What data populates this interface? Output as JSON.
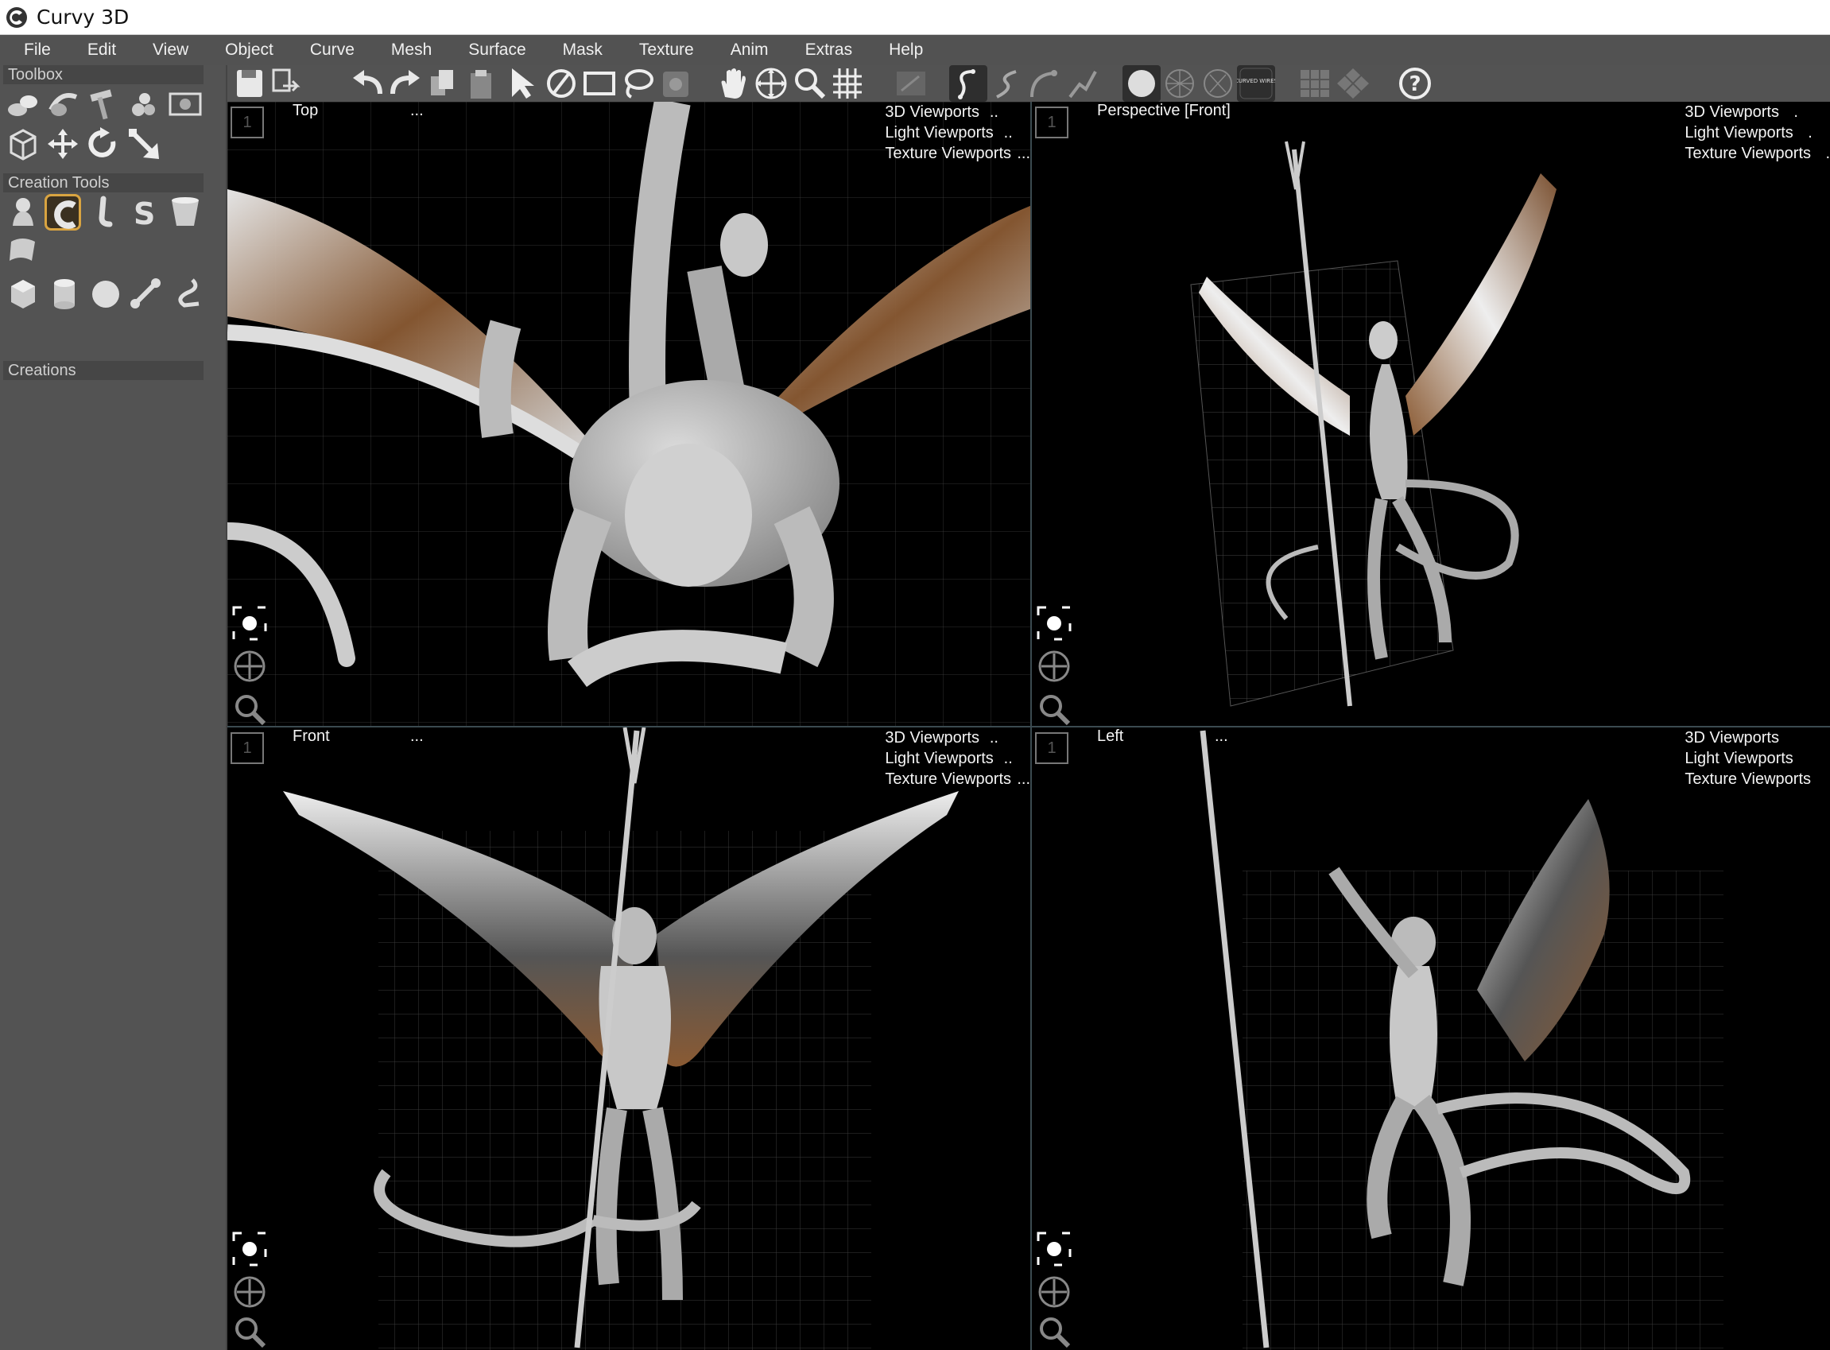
{
  "window": {
    "title": "Curvy 3D"
  },
  "menubar": {
    "items": [
      "File",
      "Edit",
      "View",
      "Object",
      "Curve",
      "Mesh",
      "Surface",
      "Mask",
      "Texture",
      "Anim",
      "Extras",
      "Help"
    ]
  },
  "leftpanel": {
    "toolbox_label": "Toolbox",
    "creation_tools_label": "Creation Tools",
    "creations_label": "Creations"
  },
  "toolbar": {
    "surface_badge": "CURVED WIRES"
  },
  "viewports": [
    {
      "name": "Top",
      "number": "1",
      "dots": "...",
      "menu": [
        "3D Viewports",
        "Light Viewports",
        "Texture Viewports"
      ],
      "menu_dots": [
        "..",
        "..",
        "..."
      ]
    },
    {
      "name": "Perspective [Front]",
      "number": "1",
      "dots": "",
      "menu": [
        "3D Viewports",
        "Light Viewports",
        "Texture Viewports"
      ],
      "menu_dots": [
        ".",
        ".",
        "."
      ]
    },
    {
      "name": "Front",
      "number": "1",
      "dots": "...",
      "menu": [
        "3D Viewports",
        "Light Viewports",
        "Texture Viewports"
      ],
      "menu_dots": [
        "..",
        "..",
        "..."
      ]
    },
    {
      "name": "Left",
      "number": "1",
      "dots": "...",
      "menu": [
        "3D Viewports",
        "Light Viewports",
        "Texture Viewports"
      ],
      "menu_dots": [
        "",
        "",
        ""
      ]
    }
  ],
  "colors": {
    "background": "#000000",
    "panel": "#535353",
    "accent_selected": "#d9a441",
    "feather_brown": "#8a5a33",
    "model_gray": "#bdbdbd"
  }
}
